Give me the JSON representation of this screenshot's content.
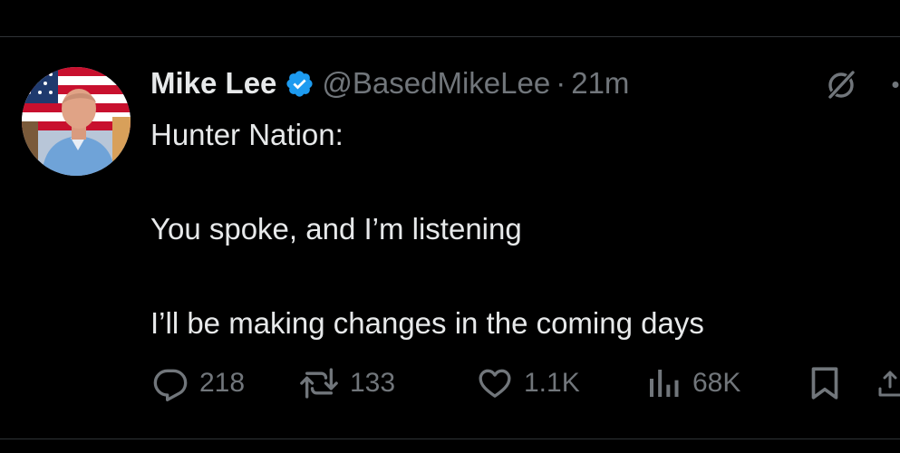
{
  "tweet": {
    "author_name": "Mike Lee",
    "handle": "@BasedMikeLee",
    "separator": "·",
    "timestamp": "21m",
    "verified": true,
    "lines": [
      "Hunter Nation:",
      "You spoke, and I’m listening",
      "I’ll be making changes in the coming days"
    ]
  },
  "stats": {
    "replies": "218",
    "reposts": "133",
    "likes": "1.1K",
    "views": "68K"
  },
  "icons": {
    "verified": "verified-badge-icon",
    "grok": "grok-icon",
    "more": "more-icon",
    "reply": "reply-icon",
    "repost": "repost-icon",
    "like": "heart-icon",
    "views": "views-icon",
    "bookmark": "bookmark-icon",
    "share": "share-icon"
  },
  "colors": {
    "background": "#000000",
    "primary_text": "#e7e9ea",
    "secondary_text": "#71767b",
    "verified_blue": "#1d9bf0",
    "divider": "#2f3336"
  }
}
